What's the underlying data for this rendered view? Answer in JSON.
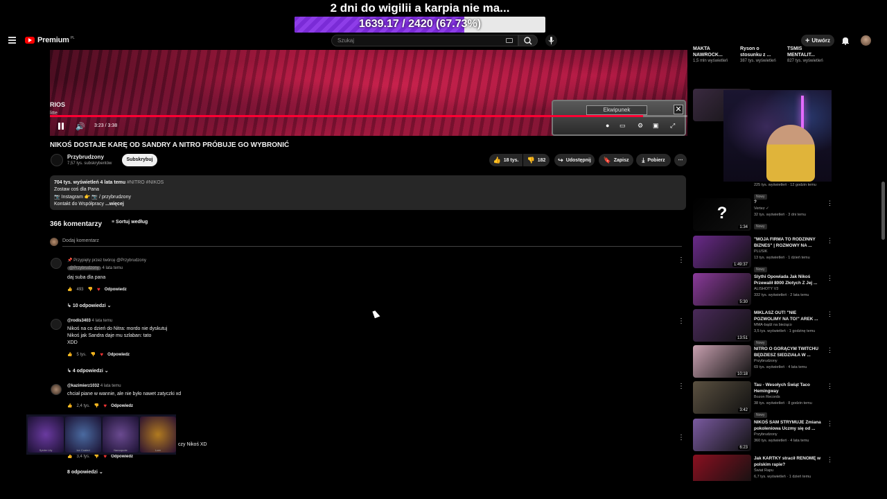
{
  "overlay": {
    "title": "2 dni do wigilii a karpia nie ma...",
    "goal_text": "1639.17 / 2420 (67.73%)",
    "goal_fraction": 0.6773
  },
  "header": {
    "brand": "Premium",
    "brand_region": "PL",
    "search_placeholder": "Szukaj",
    "create_label": "Utwórz"
  },
  "video": {
    "overlay_text": "RIOS",
    "overlay_sub": "litte",
    "time": "3:23 / 3:38",
    "progress_fraction": 0.93,
    "game_panel_title": "Ekwipunek",
    "title": "NIKOŚ DOSTAJE KARĘ OD SANDRY A NITRO PRÓBUJE GO WYBRONIĆ",
    "channel": "Przybrudzony",
    "subscribers": "7,57 tys. subskrybentów",
    "subscribe_label": "Subskrybuj",
    "likes": "18 tys.",
    "dislikes": "182",
    "share_label": "Udostępnij",
    "save_label": "Zapisz",
    "download_label": "Pobierz"
  },
  "description": {
    "stats": "704 tys. wyświetleń  4 lata temu",
    "tags": "#NITRO #NIKOS",
    "line1": "Zostaw coś dla Pana",
    "line2": "📷 Instagram 👉 📷 / przybrudzony",
    "line3": "Kontakt do Współpracy",
    "more": "...więcej"
  },
  "comments": {
    "count": "366 komentarzy",
    "sort_label": "Sortuj według",
    "add_placeholder": "Dodaj komentarz",
    "items": [
      {
        "pinned": "Przypięty przez twórcę @Przybrudzony",
        "author": "@Przybrudzony",
        "time": "4 lata temu",
        "text": [
          "daj suba dla pana"
        ],
        "likes": "493",
        "reply_label": "Odpowiedz",
        "replies": "10 odpowiedzi"
      },
      {
        "author": "@rodis3403",
        "time": "4 lata temu",
        "text": [
          "Nikoś na co dzień do Nitra: mordo nie dyskutuj",
          "Nikoś jak Sandra daje mu szlaban: tato",
          "XDD"
        ],
        "likes": "5 tys.",
        "reply_label": "Odpowiedz",
        "replies": "4 odpowiedzi"
      },
      {
        "author": "@kazimierz1032",
        "time": "4 lata temu",
        "text": [
          "chciał piane w wannie, ale nie było nawet zatyczki xd"
        ],
        "likes": "2,4 tys.",
        "reply_label": "Odpowiedz"
      },
      {
        "text": [
          "czy Nikoś XD"
        ],
        "likes": "3,4 tys.",
        "reply_label": "Odpowiedz",
        "replies": "8 odpowiedzi"
      }
    ]
  },
  "inventory_items": [
    "Spider Lily",
    "Ice Coaled",
    "Nanoquote",
    "Lore"
  ],
  "sidebar": {
    "top_row": [
      {
        "title": "MAKTA NAWROCK...",
        "meta": "1,5 mln wyświetleń"
      },
      {
        "title": "Ryson o stosunku z ...",
        "meta": "387 tys. wyświetleń"
      },
      {
        "title": "TSMIS MENTALIT...",
        "meta": "827 tys. wyświetleń"
      }
    ],
    "items": [
      {
        "title": "",
        "channel": "",
        "meta": "225 tys. wyświetleń · 12 godzin temu",
        "badge": "Nowy",
        "duration": "3:54",
        "thumb": "#3a2a40"
      },
      {
        "title": "?",
        "channel": "Vertez ✓",
        "meta": "32 tys. wyświetleń · 3 dni temu",
        "badge": "Nowy",
        "duration": "1:34",
        "thumb": "#000000"
      },
      {
        "title": "\"MOJA FIRMA TO RODZINNY BIZNES\" | ROZMOWY NA ...",
        "channel": "PLUSIK",
        "meta": "13 tys. wyświetleń · 1 dzień temu",
        "badge": "Nowy",
        "duration": "1:49:37",
        "thumb": "#6a2a8a"
      },
      {
        "title": "Slythi Opowiada Jak Nikoś Przewalił 8000 Złotych Z Jej ...",
        "channel": "ALISHOTY V3",
        "meta": "332 tys. wyświetleń · 2 lata temu",
        "badge": "",
        "duration": "5:30",
        "thumb": "#8a3a9a"
      },
      {
        "title": "MIKLASZ OUT! \"NIE POZWOLIMY NA TO!\" AREK ...",
        "channel": "MMA-bądź na bieżąco",
        "meta": "3,5 tys. wyświetleń · 1 godzinę temu",
        "badge": "Nowy",
        "duration": "13:51",
        "thumb": "#4a2a5a"
      },
      {
        "title": "NITRO O GORĄCYM TWITCHU BĘDZIESZ SIEDZIAŁA W ...",
        "channel": "Przybrudzony",
        "meta": "69 tys. wyświetleń · 4 lata temu",
        "badge": "",
        "duration": "10:18",
        "thumb": "#c8a0b0"
      },
      {
        "title": "Tau - Wesołych Świąt Taco Hemingway",
        "channel": "Bozon Records",
        "meta": "38 tys. wyświetleń · 8 godzin temu",
        "badge": "Nowy",
        "duration": "3:42",
        "thumb": "#5a5040"
      },
      {
        "title": "NIKOŚ SAM STRYMUJE Zmiana pokoleniowa Uczmy się od ...",
        "channel": "Przybrudzony",
        "meta": "360 tys. wyświetleń · 4 lata temu",
        "badge": "",
        "duration": "6:23",
        "thumb": "#7a5aa0"
      },
      {
        "title": "Jak KARTKY stracił RENOMĘ w polskim rapie?",
        "channel": "Świat Rapu",
        "meta": "6,7 tys. wyświetleń · 1 dzień temu",
        "badge": "",
        "duration": "",
        "thumb": "#8a1020"
      }
    ]
  }
}
